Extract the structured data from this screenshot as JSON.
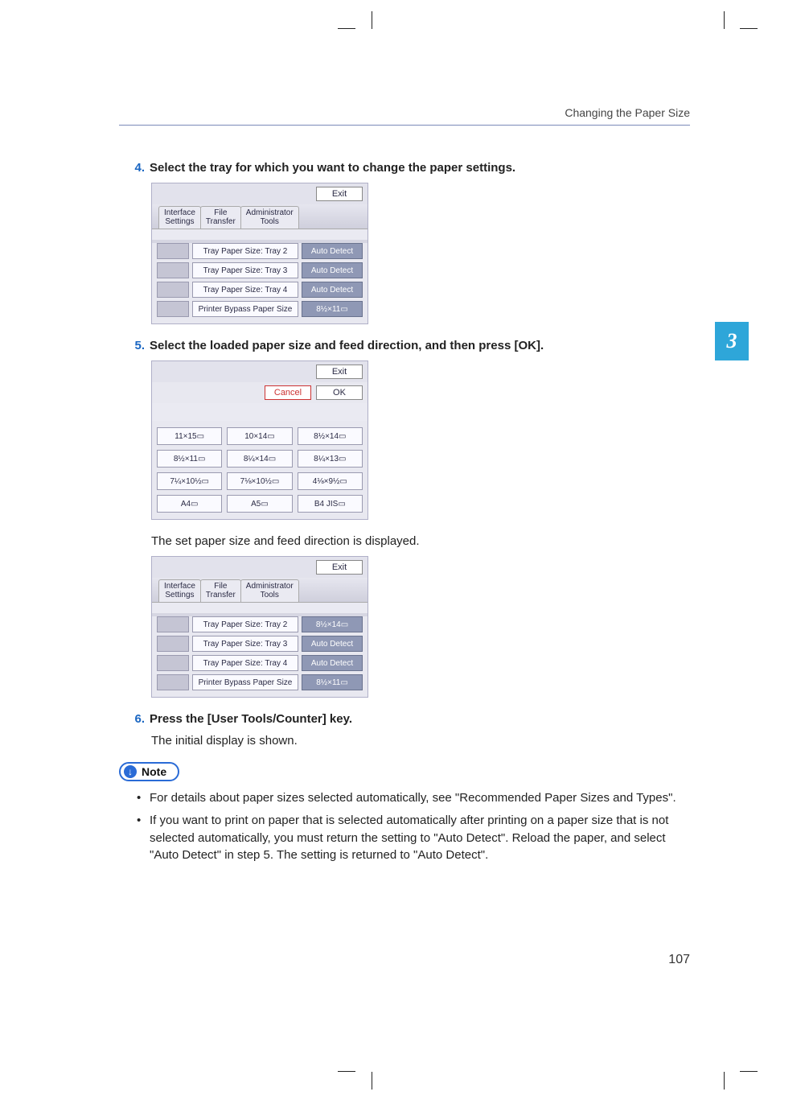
{
  "header_title": "Changing the Paper Size",
  "chapter_tab": "3",
  "page_number": "107",
  "steps": {
    "s4": {
      "num": "4.",
      "text": "Select the tray for which you want to change the paper settings."
    },
    "s5": {
      "num": "5.",
      "text": "Select the loaded paper size and feed direction, and then press [OK].",
      "sub": "The set paper size and feed direction is displayed."
    },
    "s6": {
      "num": "6.",
      "text": "Press the [User Tools/Counter] key.",
      "sub": "The initial display is shown."
    }
  },
  "panel_common": {
    "exit": "Exit",
    "cancel": "Cancel",
    "ok": "OK",
    "tabs": [
      "Interface\nSettings",
      "File\nTransfer",
      "Administrator\nTools"
    ]
  },
  "panel1_rows": [
    {
      "label": "Tray Paper Size: Tray 2",
      "val": "Auto Detect"
    },
    {
      "label": "Tray Paper Size: Tray 3",
      "val": "Auto Detect"
    },
    {
      "label": "Tray Paper Size: Tray 4",
      "val": "Auto Detect"
    },
    {
      "label": "Printer Bypass Paper Size",
      "val": "8½×11▭"
    }
  ],
  "panel2_sizes": [
    "11×15▭",
    "10×14▭",
    "8½×14▭",
    "8½×11▭",
    "8¼×14▭",
    "8¼×13▭",
    "7¼×10½▭",
    "7⅛×10½▭",
    "4⅛×9½▭",
    "A4▭",
    "A5▭",
    "B4 JIS▭"
  ],
  "panel3_rows": [
    {
      "label": "Tray Paper Size: Tray 2",
      "val": "8½×14▭"
    },
    {
      "label": "Tray Paper Size: Tray 3",
      "val": "Auto Detect"
    },
    {
      "label": "Tray Paper Size: Tray 4",
      "val": "Auto Detect"
    },
    {
      "label": "Printer Bypass Paper Size",
      "val": "8½×11▭"
    }
  ],
  "note_label": "Note",
  "notes": [
    "For details about paper sizes selected automatically, see \"Recommended Paper Sizes and Types\".",
    "If you want to print on paper that is selected automatically after printing on a paper size that is not selected automatically, you must return the setting to \"Auto Detect\". Reload the paper, and select \"Auto Detect\" in step 5. The setting is returned to \"Auto Detect\"."
  ]
}
